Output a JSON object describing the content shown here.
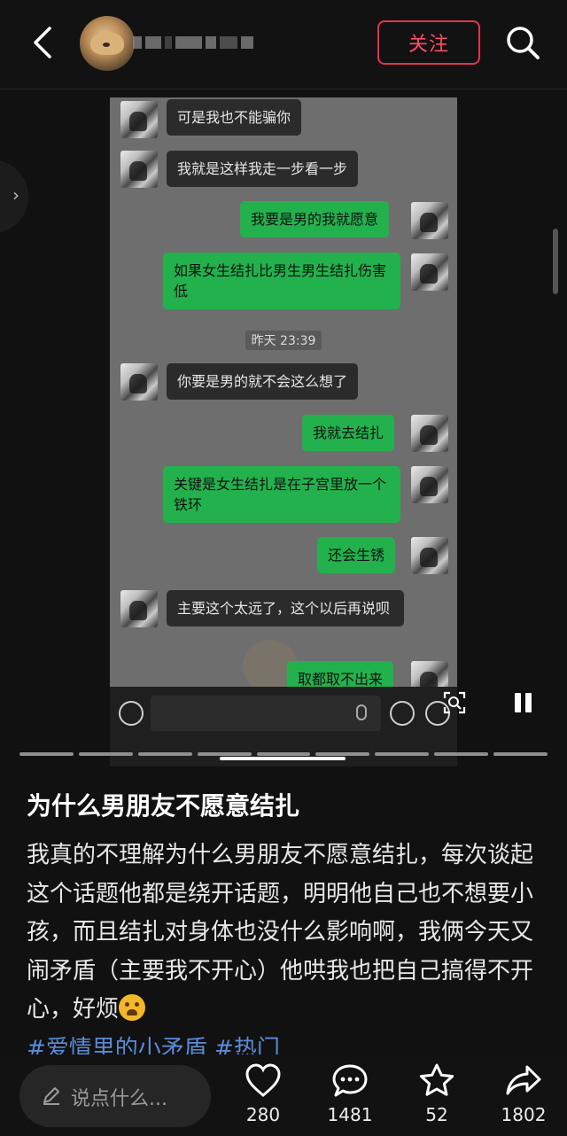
{
  "header": {
    "follow_label": "关注"
  },
  "screenshot": {
    "messages": [
      {
        "side": "in",
        "text": "可是我也不能骗你"
      },
      {
        "side": "in",
        "text": "我就是这样我走一步看一步"
      },
      {
        "side": "out",
        "text": "我要是男的我就愿意"
      },
      {
        "side": "out",
        "text": "如果女生结扎比男生男生结扎伤害低"
      },
      {
        "side": "in",
        "text": "你要是男的就不会这么想了"
      },
      {
        "side": "out",
        "text": "我就去结扎"
      },
      {
        "side": "out",
        "text": "关键是女生结扎是在子宫里放一个铁环"
      },
      {
        "side": "out",
        "text": "还会生锈"
      },
      {
        "side": "in",
        "text": "主要这个太远了，这个以后再说呗"
      },
      {
        "side": "out",
        "text": "取都取不出来"
      }
    ],
    "timestamp": "昨天 23:39"
  },
  "post": {
    "title": "为什么男朋友不愿意结扎",
    "body": "我真的不理解为什么男朋友不愿意结扎，每次谈起这个话题他都是绕开话题，明明他自己也不想要小孩，而且结扎对身体也没什么影响啊，我俩今天又闹矛盾（主要我不开心）他哄我也把自己搞得不开心，好烦",
    "tags": "#爱情里的小矛盾 #热门"
  },
  "bottom_bar": {
    "comment_placeholder": "说点什么...",
    "likes": "280",
    "comments": "1481",
    "favorites": "52",
    "shares": "1802"
  },
  "colors": {
    "accent": "#e6314f",
    "bubble_out": "#23b14d",
    "tag": "#5b8bd8"
  }
}
